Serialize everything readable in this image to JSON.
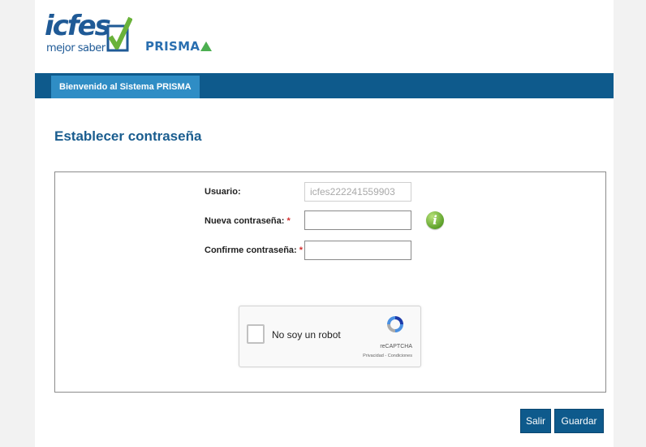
{
  "header": {
    "brand": "icfes",
    "brand_sub": "mejor saber",
    "product": "PRISM",
    "product_last": "A",
    "nav_tab": "Bienvenido al Sistema PRISMA"
  },
  "page": {
    "title": "Establecer contraseña"
  },
  "form": {
    "usuario_label": "Usuario:",
    "usuario_value": "icfes222241559903",
    "nueva_label": "Nueva contraseña:",
    "confirm_label": "Confirme contraseña:",
    "required_mark": "*",
    "info_icon": "info-icon"
  },
  "captcha": {
    "label": "No soy un robot",
    "brand": "reCAPTCHA",
    "terms": "Privacidad - Condiciones"
  },
  "actions": {
    "exit_label": "Salir",
    "save_label": "Guardar"
  },
  "colors": {
    "brand_blue": "#0e5a8c",
    "tab_blue": "#2f8dc5",
    "title_blue": "#1a5d8f",
    "required_red": "#d32f2f",
    "logo_green": "#4caf50"
  }
}
